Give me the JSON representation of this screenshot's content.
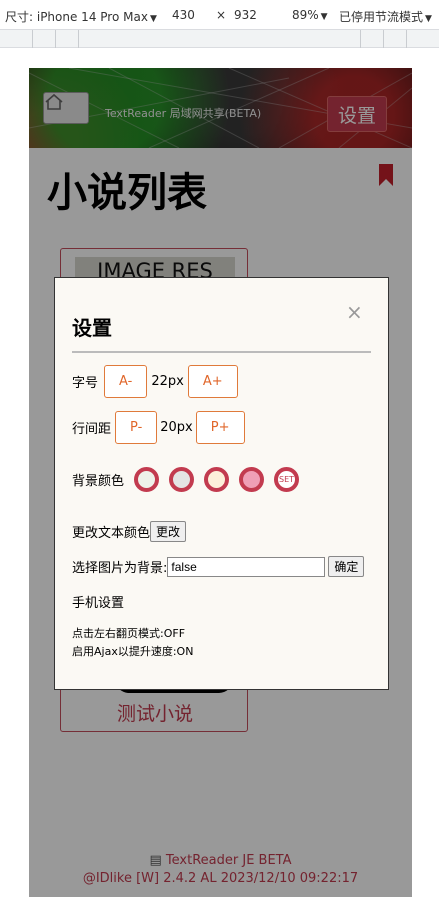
{
  "devtools": {
    "size_label": "尺寸: iPhone 14 Pro Max",
    "width": "430",
    "times": "×",
    "height": "932",
    "zoom": "89%",
    "throttle": "已停用节流模式"
  },
  "header": {
    "title": "TextReader 局域网共享(BETA)",
    "settings_button": "设置"
  },
  "page": {
    "title": "小说列表"
  },
  "card": {
    "image_placeholder": "IMAGE RES",
    "novel_title": "测试小说"
  },
  "footer": {
    "line1": "TextReader JE BETA",
    "line2": "@IDlike [W] 2.4.2 AL 2023/12/10 09:22:17"
  },
  "modal": {
    "title": "设置",
    "close": "×",
    "font_size": {
      "label": "字号",
      "dec": "A-",
      "value": "22px",
      "inc": "A+"
    },
    "line_height": {
      "label": "行间距",
      "dec": "P-",
      "value": "20px",
      "inc": "P+"
    },
    "bg_color": {
      "label": "背景颜色",
      "swatches": [
        "#eef2ea",
        "#e4e4e4",
        "#fdf0da",
        "#ef9fb6",
        "#ffffff"
      ],
      "custom_label": "SET"
    },
    "text_color": {
      "label": "更改文本颜色",
      "button": "更改"
    },
    "bg_image": {
      "label": "选择图片为背景:",
      "value": "false",
      "button": "确定"
    },
    "mobile_settings": "手机设置",
    "tap_mode": "点击左右翻页模式:OFF",
    "ajax": "启用Ajax以提升速度:ON"
  },
  "colors": {
    "accent": "#c23b4f",
    "orange": "#e0662a"
  }
}
